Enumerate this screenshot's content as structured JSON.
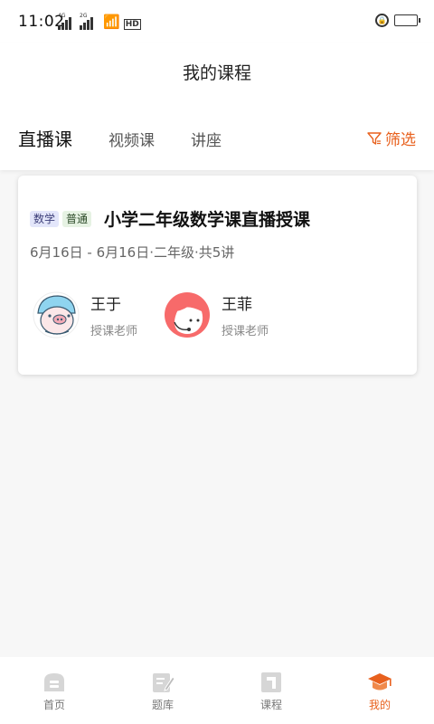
{
  "status_bar": {
    "time": "11:02",
    "net1": "4G",
    "net2": "2G",
    "hd": "HD"
  },
  "header": {
    "title": "我的课程",
    "tabs": [
      {
        "label": "直播课",
        "active": true
      },
      {
        "label": "视频课",
        "active": false
      },
      {
        "label": "讲座",
        "active": false
      }
    ],
    "filter_label": "筛选"
  },
  "course": {
    "subject_tag": "数学",
    "level_tag": "普通",
    "title": "小学二年级数学课直播授课",
    "meta": "6月16日 - 6月16日·二年级·共5讲",
    "teachers": [
      {
        "name": "王于",
        "role": "授课老师",
        "avatar": "pig-helmet-avatar"
      },
      {
        "name": "王菲",
        "role": "授课老师",
        "avatar": "girl-avatar"
      }
    ]
  },
  "tabbar": {
    "items": [
      {
        "label": "首页",
        "icon": "home-icon",
        "active": false
      },
      {
        "label": "题库",
        "icon": "edit-icon",
        "active": false
      },
      {
        "label": "课程",
        "icon": "course-icon",
        "active": false
      },
      {
        "label": "我的",
        "icon": "graduation-cap-icon",
        "active": true
      }
    ]
  },
  "colors": {
    "accent": "#e8611e",
    "subject_tag_bg": "#e3e6fa",
    "level_tag_bg": "#e6f2e3"
  }
}
